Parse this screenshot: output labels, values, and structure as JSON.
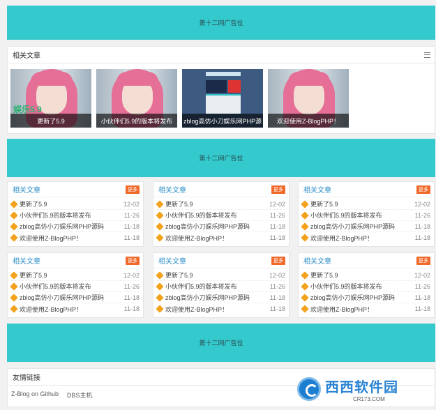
{
  "ads": [
    "第十二网广告位",
    "第十二网广告位",
    "第十二网广告位"
  ],
  "related": {
    "title": "相关文章",
    "thumbs": [
      {
        "caption": "更新了5.9",
        "overlay": "娱乐5.9",
        "image": "pink-hair-girl"
      },
      {
        "caption": "小伙伴们5.9的版本将发布",
        "image": "pink-hair-girl"
      },
      {
        "caption": "zblog高仿小刀娱乐网PHP源",
        "image": "site-screenshot"
      },
      {
        "caption": "欢迎使用Z-BlogPHP！",
        "image": "pink-hair-girl"
      }
    ]
  },
  "boxes": [
    {
      "title": "相关文章",
      "more": "更多",
      "items": [
        {
          "title": "更新了5.9",
          "date": "12-02"
        },
        {
          "title": "小伙伴们5.9的版本将发布",
          "date": "11-26"
        },
        {
          "title": "zblog高仿小刀娱乐网PHP源码",
          "date": "11-18"
        },
        {
          "title": "欢迎使用Z-BlogPHP！",
          "date": "11-18"
        }
      ]
    },
    {
      "title": "相关文章",
      "more": "更多",
      "items": [
        {
          "title": "更新了5.9",
          "date": "12-02"
        },
        {
          "title": "小伙伴们5.9的版本将发布",
          "date": "11-26"
        },
        {
          "title": "zblog高仿小刀娱乐网PHP源码",
          "date": "11-18"
        },
        {
          "title": "欢迎使用Z-BlogPHP！",
          "date": "11-18"
        }
      ]
    },
    {
      "title": "相关文章",
      "more": "更多",
      "items": [
        {
          "title": "更新了5.9",
          "date": "12-02"
        },
        {
          "title": "小伙伴们5.9的版本将发布",
          "date": "11-26"
        },
        {
          "title": "zblog高仿小刀娱乐网PHP源码",
          "date": "11-18"
        },
        {
          "title": "欢迎使用Z-BlogPHP！",
          "date": "11-18"
        }
      ]
    },
    {
      "title": "相关文章",
      "more": "更多",
      "items": [
        {
          "title": "更新了5.9",
          "date": "12-02"
        },
        {
          "title": "小伙伴们5.9的版本将发布",
          "date": "11-26"
        },
        {
          "title": "zblog高仿小刀娱乐网PHP源码",
          "date": "11-18"
        },
        {
          "title": "欢迎使用Z-BlogPHP！",
          "date": "11-18"
        }
      ]
    },
    {
      "title": "相关文章",
      "more": "更多",
      "items": [
        {
          "title": "更新了5.9",
          "date": "12-02"
        },
        {
          "title": "小伙伴们5.9的版本将发布",
          "date": "11-26"
        },
        {
          "title": "zblog高仿小刀娱乐网PHP源码",
          "date": "11-18"
        },
        {
          "title": "欢迎使用Z-BlogPHP！",
          "date": "11-18"
        }
      ]
    },
    {
      "title": "相关文章",
      "more": "更多",
      "items": [
        {
          "title": "更新了5.9",
          "date": "12-02"
        },
        {
          "title": "小伙伴们5.9的版本将发布",
          "date": "11-26"
        },
        {
          "title": "zblog高仿小刀娱乐网PHP源码",
          "date": "11-18"
        },
        {
          "title": "欢迎使用Z-BlogPHP！",
          "date": "11-18"
        }
      ]
    }
  ],
  "friends": {
    "title": "友情链接",
    "links": [
      "Z-Blog on Github",
      "DBS主机"
    ]
  },
  "watermark": {
    "brand": "西西软件园",
    "url": "CR173.COM"
  },
  "colors": {
    "ad_bg": "#33c9cd",
    "accent_link": "#2a8cc6",
    "more_btn": "#f06a2b",
    "star": "#f3a21d"
  }
}
